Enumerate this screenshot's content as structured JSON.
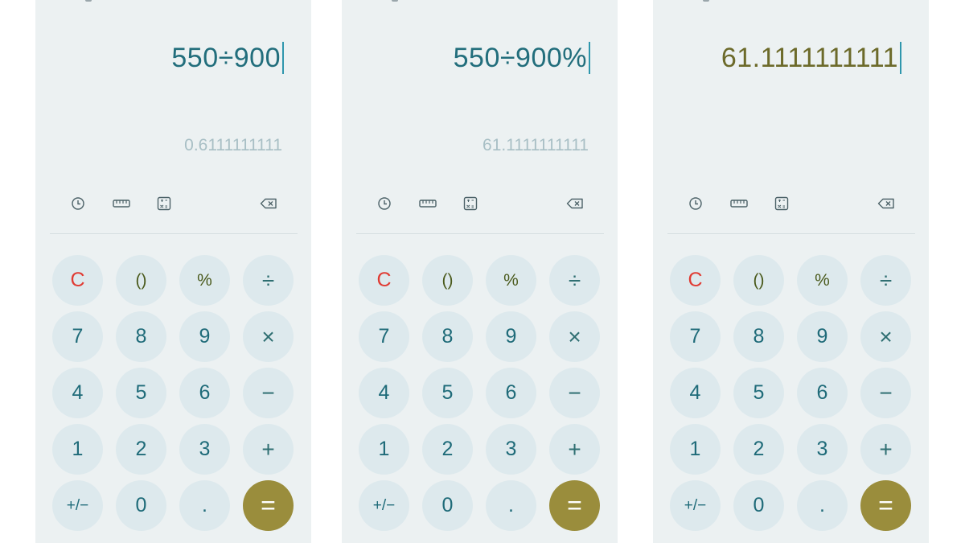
{
  "screens": [
    {
      "expression": "550÷900",
      "preview": "0.6111111111",
      "is_result": false
    },
    {
      "expression": "550÷900%",
      "preview": "61.1111111111",
      "is_result": false
    },
    {
      "expression": "61.1111111111",
      "preview": "",
      "is_result": true
    }
  ],
  "keys": {
    "clear": "C",
    "parentheses": "()",
    "percent": "%",
    "divide": "÷",
    "seven": "7",
    "eight": "8",
    "nine": "9",
    "multiply": "×",
    "four": "4",
    "five": "5",
    "six": "6",
    "minus": "−",
    "one": "1",
    "two": "2",
    "three": "3",
    "plus": "+",
    "plus_minus": "+/−",
    "zero": "0",
    "decimal": ".",
    "equals": "="
  },
  "colors": {
    "screen_bg": "#ecf1f2",
    "key_bg": "#dde9ed",
    "equals_bg": "#9a8d3c",
    "clear_text": "#e03a32",
    "expression_text": "#226e7c",
    "result_text": "#6c6a2a",
    "caret": "#2f97ad"
  },
  "toolbar_icons": [
    "history-icon",
    "unit-converter-icon",
    "scientific-mode-icon",
    "backspace-icon"
  ]
}
